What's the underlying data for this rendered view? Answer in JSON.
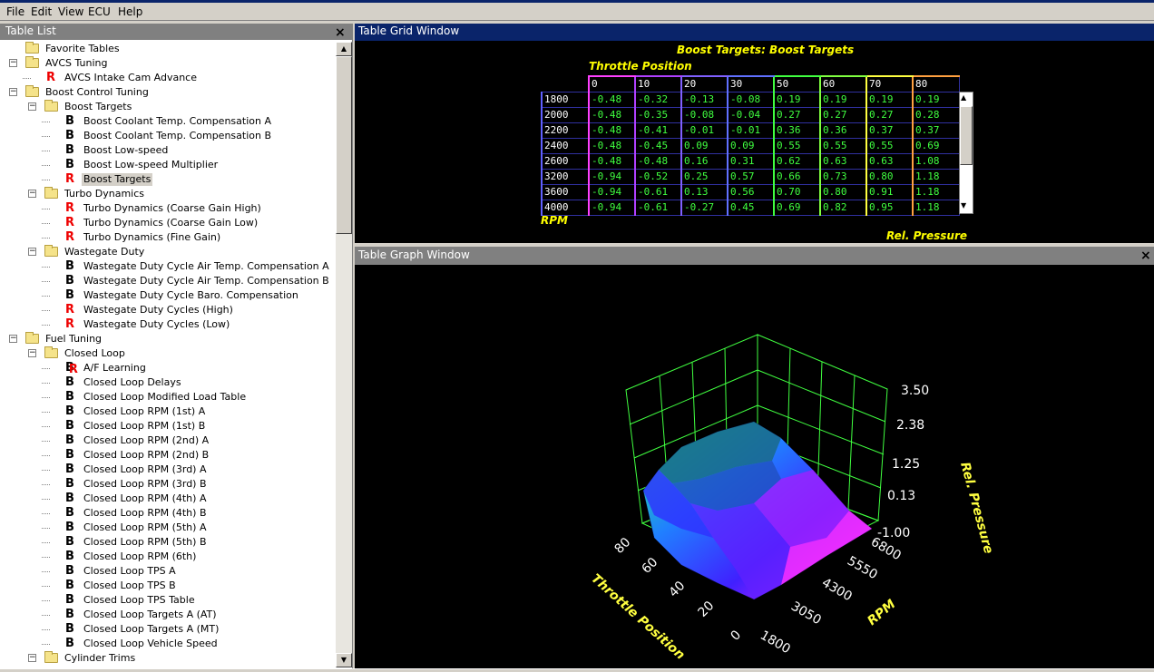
{
  "menu": [
    "File",
    "Edit",
    "View",
    "ECU",
    "Help"
  ],
  "table_list": {
    "title": "Table List",
    "close": "×",
    "items": [
      {
        "label": "Favorite Tables",
        "kind": "folder",
        "level": 0,
        "expander": ""
      },
      {
        "label": "AVCS Tuning",
        "kind": "folder",
        "level": 0,
        "expander": "−"
      },
      {
        "label": "AVCS Intake Cam Advance",
        "kind": "R",
        "level": 1,
        "expander": ""
      },
      {
        "label": "Boost Control Tuning",
        "kind": "folder",
        "level": 0,
        "expander": "−"
      },
      {
        "label": "Boost Targets",
        "kind": "folder",
        "level": 1,
        "expander": "−"
      },
      {
        "label": "Boost Coolant Temp. Compensation A",
        "kind": "B",
        "level": 2,
        "expander": ""
      },
      {
        "label": "Boost Coolant Temp. Compensation B",
        "kind": "B",
        "level": 2,
        "expander": ""
      },
      {
        "label": "Boost Low-speed",
        "kind": "B",
        "level": 2,
        "expander": ""
      },
      {
        "label": "Boost Low-speed Multiplier",
        "kind": "B",
        "level": 2,
        "expander": ""
      },
      {
        "label": "Boost Targets",
        "kind": "R",
        "level": 2,
        "expander": "",
        "selected": true
      },
      {
        "label": "Turbo Dynamics",
        "kind": "folder",
        "level": 1,
        "expander": "−"
      },
      {
        "label": "Turbo Dynamics (Coarse Gain High)",
        "kind": "R",
        "level": 2,
        "expander": ""
      },
      {
        "label": "Turbo Dynamics (Coarse Gain Low)",
        "kind": "R",
        "level": 2,
        "expander": ""
      },
      {
        "label": "Turbo Dynamics (Fine Gain)",
        "kind": "R",
        "level": 2,
        "expander": ""
      },
      {
        "label": "Wastegate Duty",
        "kind": "folder",
        "level": 1,
        "expander": "−"
      },
      {
        "label": "Wastegate Duty Cycle Air Temp. Compensation A",
        "kind": "B",
        "level": 2,
        "expander": ""
      },
      {
        "label": "Wastegate Duty Cycle Air Temp. Compensation B",
        "kind": "B",
        "level": 2,
        "expander": ""
      },
      {
        "label": "Wastegate Duty Cycle Baro. Compensation",
        "kind": "B",
        "level": 2,
        "expander": ""
      },
      {
        "label": "Wastegate Duty Cycles (High)",
        "kind": "R",
        "level": 2,
        "expander": ""
      },
      {
        "label": "Wastegate Duty Cycles (Low)",
        "kind": "R",
        "level": 2,
        "expander": ""
      },
      {
        "label": "Fuel Tuning",
        "kind": "folder",
        "level": 0,
        "expander": "−"
      },
      {
        "label": "Closed Loop",
        "kind": "folder",
        "level": 1,
        "expander": "−"
      },
      {
        "label": "A/F Learning",
        "kind": "BR",
        "level": 2,
        "expander": ""
      },
      {
        "label": "Closed Loop Delays",
        "kind": "B",
        "level": 2,
        "expander": ""
      },
      {
        "label": "Closed Loop Modified Load Table",
        "kind": "B",
        "level": 2,
        "expander": ""
      },
      {
        "label": "Closed Loop RPM (1st) A",
        "kind": "B",
        "level": 2,
        "expander": ""
      },
      {
        "label": "Closed Loop RPM (1st) B",
        "kind": "B",
        "level": 2,
        "expander": ""
      },
      {
        "label": "Closed Loop RPM (2nd) A",
        "kind": "B",
        "level": 2,
        "expander": ""
      },
      {
        "label": "Closed Loop RPM (2nd) B",
        "kind": "B",
        "level": 2,
        "expander": ""
      },
      {
        "label": "Closed Loop RPM (3rd) A",
        "kind": "B",
        "level": 2,
        "expander": ""
      },
      {
        "label": "Closed Loop RPM (3rd) B",
        "kind": "B",
        "level": 2,
        "expander": ""
      },
      {
        "label": "Closed Loop RPM (4th) A",
        "kind": "B",
        "level": 2,
        "expander": ""
      },
      {
        "label": "Closed Loop RPM (4th) B",
        "kind": "B",
        "level": 2,
        "expander": ""
      },
      {
        "label": "Closed Loop RPM (5th) A",
        "kind": "B",
        "level": 2,
        "expander": ""
      },
      {
        "label": "Closed Loop RPM (5th) B",
        "kind": "B",
        "level": 2,
        "expander": ""
      },
      {
        "label": "Closed Loop RPM (6th)",
        "kind": "B",
        "level": 2,
        "expander": ""
      },
      {
        "label": "Closed Loop TPS A",
        "kind": "B",
        "level": 2,
        "expander": ""
      },
      {
        "label": "Closed Loop TPS B",
        "kind": "B",
        "level": 2,
        "expander": ""
      },
      {
        "label": "Closed Loop TPS Table",
        "kind": "B",
        "level": 2,
        "expander": ""
      },
      {
        "label": "Closed Loop Targets A (AT)",
        "kind": "B",
        "level": 2,
        "expander": ""
      },
      {
        "label": "Closed Loop Targets A (MT)",
        "kind": "B",
        "level": 2,
        "expander": ""
      },
      {
        "label": "Closed Loop Vehicle Speed",
        "kind": "B",
        "level": 2,
        "expander": ""
      },
      {
        "label": "Cylinder Trims",
        "kind": "folder",
        "level": 1,
        "expander": "−"
      }
    ]
  },
  "grid_window": {
    "title": "Table Grid Window",
    "table_title": "Boost Targets: Boost Targets",
    "x_axis_label": "Throttle Position",
    "y_axis_label": "RPM",
    "value_label": "Rel. Pressure",
    "columns": [
      "0",
      "10",
      "20",
      "30",
      "50",
      "60",
      "70",
      "80"
    ],
    "column_colors": [
      "#ff40ff",
      "#b040ff",
      "#8060ff",
      "#6070ff",
      "#40ff40",
      "#80ff40",
      "#ffff40",
      "#ffa040"
    ],
    "rows": [
      {
        "rpm": "1800",
        "values": [
          "-0.48",
          "-0.32",
          "-0.13",
          "-0.08",
          "0.19",
          "0.19",
          "0.19",
          "0.19"
        ]
      },
      {
        "rpm": "2000",
        "values": [
          "-0.48",
          "-0.35",
          "-0.08",
          "-0.04",
          "0.27",
          "0.27",
          "0.27",
          "0.28"
        ]
      },
      {
        "rpm": "2200",
        "values": [
          "-0.48",
          "-0.41",
          "-0.01",
          "-0.01",
          "0.36",
          "0.36",
          "0.37",
          "0.37"
        ]
      },
      {
        "rpm": "2400",
        "values": [
          "-0.48",
          "-0.45",
          "0.09",
          "0.09",
          "0.55",
          "0.55",
          "0.55",
          "0.69"
        ]
      },
      {
        "rpm": "2600",
        "values": [
          "-0.48",
          "-0.48",
          "0.16",
          "0.31",
          "0.62",
          "0.63",
          "0.63",
          "1.08"
        ]
      },
      {
        "rpm": "3200",
        "values": [
          "-0.94",
          "-0.52",
          "0.25",
          "0.57",
          "0.66",
          "0.73",
          "0.80",
          "1.18"
        ]
      },
      {
        "rpm": "3600",
        "values": [
          "-0.94",
          "-0.61",
          "0.13",
          "0.56",
          "0.70",
          "0.80",
          "0.91",
          "1.18"
        ]
      },
      {
        "rpm": "4000",
        "values": [
          "-0.94",
          "-0.61",
          "-0.27",
          "0.45",
          "0.69",
          "0.82",
          "0.95",
          "1.18"
        ]
      }
    ]
  },
  "graph_window": {
    "title": "Table Graph Window",
    "close": "×",
    "z_ticks": [
      "3.50",
      "2.38",
      "1.25",
      "0.13",
      "-1.00"
    ],
    "rpm_ticks": [
      "1800",
      "3050",
      "4300",
      "5550",
      "6800"
    ],
    "throttle_ticks": [
      "0",
      "20",
      "40",
      "60",
      "80"
    ],
    "axis_labels": {
      "z": "Rel. Pressure",
      "rpm": "RPM",
      "throttle": "Throttle Position"
    },
    "grid_color": "#40ff40",
    "label_color": "#ffff40"
  }
}
